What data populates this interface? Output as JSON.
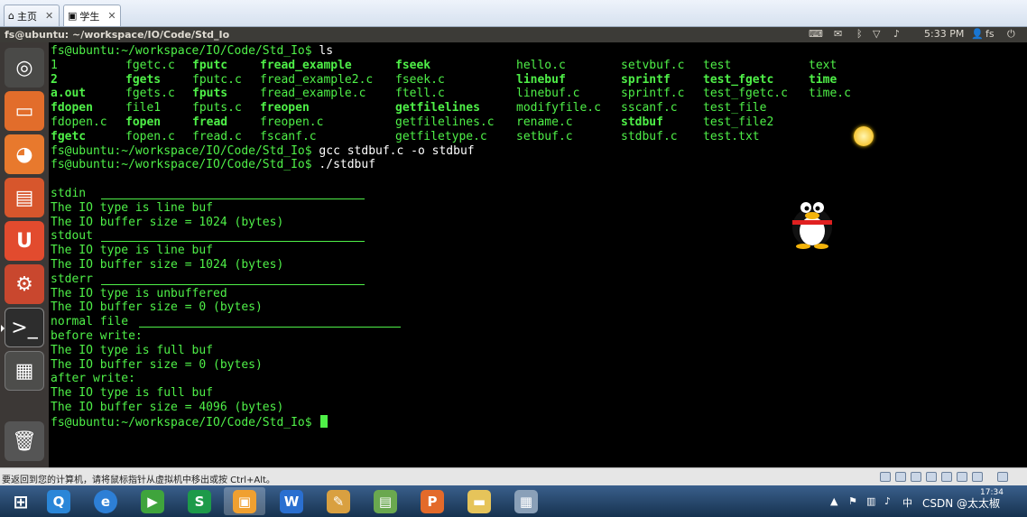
{
  "vm_tabs": [
    {
      "label": "主页",
      "icon": "home-icon"
    },
    {
      "label": "学生",
      "icon": "vm-icon"
    }
  ],
  "panel": {
    "title": "fs@ubuntu: ~/workspace/IO/Code/Std_Io",
    "clock": "5:33 PM",
    "user": "fs",
    "indicators": [
      "keyboard-icon",
      "mail-icon",
      "bluetooth-icon",
      "network-icon",
      "volume-icon",
      "power-icon"
    ]
  },
  "launcher": [
    "ubuntu-dash-icon",
    "files-icon",
    "firefox-icon",
    "software-center-icon",
    "ubuntu-one-icon",
    "system-settings-icon",
    "terminal-icon",
    "workspace-switcher-icon",
    "trash-icon"
  ],
  "terminal": {
    "prompt": "fs@ubuntu:~/workspace/IO/Code/Std_Io$",
    "cmd_ls": " ls",
    "ls_rows": [
      [
        "1",
        "fgetc.c",
        "fputc",
        "fread_example",
        "fseek",
        "hello.c",
        "setvbuf.c",
        "test",
        "text"
      ],
      [
        "2",
        "fgets",
        "fputc.c",
        "fread_example2.c",
        "fseek.c",
        "linebuf",
        "sprintf",
        "test_fgetc",
        "time"
      ],
      [
        "a.out",
        "fgets.c",
        "fputs",
        "fread_example.c",
        "ftell.c",
        "linebuf.c",
        "sprintf.c",
        "test_fgetc.c",
        "time.c"
      ],
      [
        "fdopen",
        "file1",
        "fputs.c",
        "freopen",
        "getfilelines",
        "modifyfile.c",
        "sscanf.c",
        "test_file",
        ""
      ],
      [
        "fdopen.c",
        "fopen",
        "fread",
        "freopen.c",
        "getfilelines.c",
        "rename.c",
        "stdbuf",
        "test_file2",
        ""
      ],
      [
        "fgetc",
        "fopen.c",
        "fread.c",
        "fscanf.c",
        "getfiletype.c",
        "setbuf.c",
        "stdbuf.c",
        "test.txt",
        ""
      ]
    ],
    "ls_bold": [
      [
        false,
        false,
        true,
        true,
        true,
        false,
        false,
        false,
        false
      ],
      [
        true,
        true,
        false,
        false,
        false,
        true,
        true,
        true,
        true
      ],
      [
        true,
        false,
        true,
        false,
        false,
        false,
        false,
        false,
        false
      ],
      [
        true,
        false,
        false,
        true,
        true,
        false,
        false,
        false,
        false
      ],
      [
        false,
        true,
        true,
        false,
        false,
        false,
        true,
        false,
        false
      ],
      [
        true,
        false,
        false,
        false,
        false,
        false,
        false,
        false,
        false
      ]
    ],
    "cmd_gcc": " gcc stdbuf.c -o stdbuf",
    "cmd_run": " ./stdbuf",
    "output": [
      "",
      "stdin",
      "The IO type is line buf",
      "The IO buffer size = 1024 (bytes)",
      "stdout",
      "The IO type is line buf",
      "The IO buffer size = 1024 (bytes)",
      "stderr",
      "The IO type is unbuffered",
      "The IO buffer size = 0 (bytes)",
      "normal file",
      "before write:",
      "The IO type is full buf",
      "The IO buffer size = 0 (bytes)",
      "after write:",
      "The IO type is full buf",
      "The IO buffer size = 4096 (bytes)"
    ],
    "final_prompt": "fs@ubuntu:~/workspace/IO/Code/Std_Io$ "
  },
  "status": {
    "message": "要返回到您的计算机，请将鼠标指针从虚拟机中移出或按 Ctrl+Alt。"
  },
  "taskbar": {
    "apps": [
      "windows-start-icon",
      "qq-icon",
      "ie-icon",
      "media-player-icon",
      "wps-sheet-icon",
      "vmware-icon",
      "wps-writer-icon",
      "paint-icon",
      "notepad-icon",
      "wps-presentation-icon",
      "file-explorer-icon",
      "calculator-icon"
    ],
    "clock": "17:34",
    "watermark": "CSDN @太太椒"
  }
}
